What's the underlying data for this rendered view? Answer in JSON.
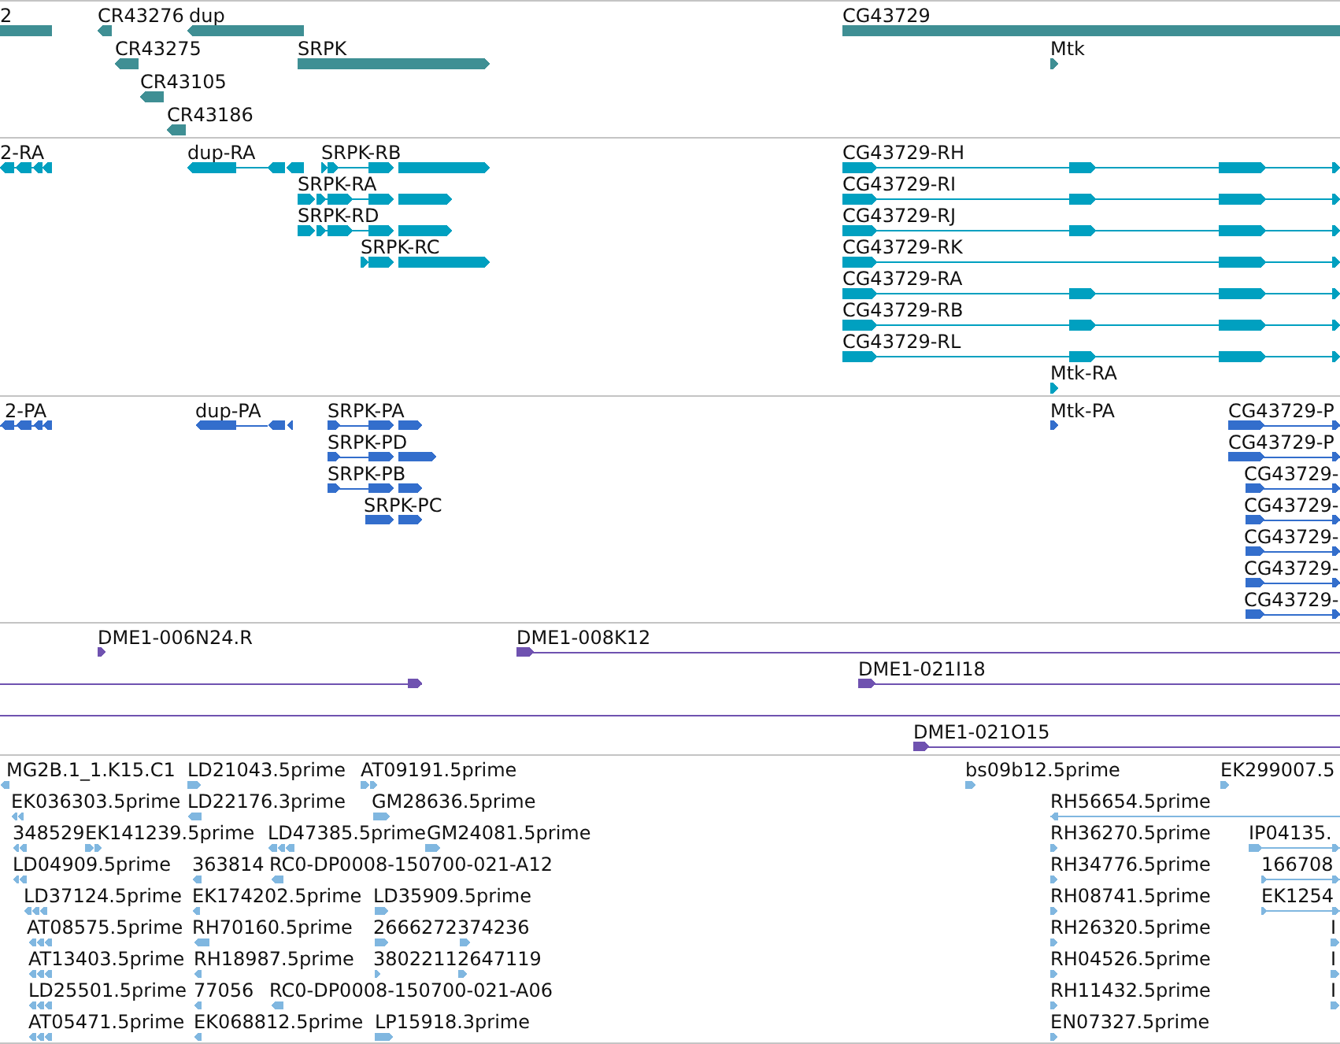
{
  "tracks": [
    {
      "kind": "gene",
      "color": "#3f8f94",
      "features": [
        {
          "label": "2"
        },
        {
          "label": "CR43276",
          "reverse": true
        },
        {
          "label": "dup",
          "reverse": true
        },
        {
          "label": "CG43729"
        },
        {
          "label": "CR43275",
          "reverse": true
        },
        {
          "label": "SRPK",
          "reverse": false
        },
        {
          "label": "Mtk",
          "reverse": false
        },
        {
          "label": "CR43105",
          "reverse": true
        },
        {
          "label": "CR43186",
          "reverse": true
        }
      ]
    },
    {
      "kind": "transcript",
      "color": "#00a0c0",
      "features": [
        {
          "label": "2-RA",
          "reverse": true
        },
        {
          "label": "dup-RA",
          "reverse": true
        },
        {
          "label": "SRPK-RB",
          "reverse": false
        },
        {
          "label": "CG43729-RH",
          "reverse": false
        },
        {
          "label": "SRPK-RA",
          "reverse": false
        },
        {
          "label": "CG43729-RI",
          "reverse": false
        },
        {
          "label": "SRPK-RD",
          "reverse": false
        },
        {
          "label": "CG43729-RJ",
          "reverse": false
        },
        {
          "label": "SRPK-RC",
          "reverse": false
        },
        {
          "label": "CG43729-RK",
          "reverse": false
        },
        {
          "label": "CG43729-RA",
          "reverse": false
        },
        {
          "label": "CG43729-RB",
          "reverse": false
        },
        {
          "label": "CG43729-RL",
          "reverse": false
        },
        {
          "label": "Mtk-RA",
          "reverse": false
        }
      ]
    },
    {
      "kind": "protein",
      "color": "#336ecc",
      "features": [
        {
          "label": "2-PA",
          "reverse": true
        },
        {
          "label": "dup-PA",
          "reverse": true
        },
        {
          "label": "SRPK-PA",
          "reverse": false
        },
        {
          "label": "Mtk-PA",
          "reverse": false
        },
        {
          "label": "CG43729-P",
          "reverse": false
        },
        {
          "label": "SRPK-PD",
          "reverse": false
        },
        {
          "label": "CG43729-P",
          "reverse": false
        },
        {
          "label": "SRPK-PB",
          "reverse": false
        },
        {
          "label": "CG43729-",
          "reverse": false
        },
        {
          "label": "SRPK-PC",
          "reverse": false
        },
        {
          "label": "CG43729-",
          "reverse": false
        },
        {
          "label": "CG43729-",
          "reverse": false
        },
        {
          "label": "CG43729-",
          "reverse": false
        },
        {
          "label": "CG43729-",
          "reverse": false
        }
      ]
    },
    {
      "kind": "clone",
      "color": "#6f52b0",
      "features": [
        {
          "kind": "arrow",
          "label": "DME1-006N24.R",
          "reverse": false
        },
        {
          "kind": "arrow",
          "label": "DME1-008K12",
          "reverse": false
        },
        {
          "kind": "arrow",
          "reverse": false
        },
        {
          "kind": "arrow",
          "label": "DME1-021I18",
          "reverse": false
        },
        {
          "kind": "line"
        },
        {
          "kind": "arrow",
          "label": "DME1-021O15",
          "reverse": false
        }
      ]
    },
    {
      "kind": "est",
      "color": "#80b7e0",
      "features": [
        {
          "label": "MG2B.1_1.K15.C1",
          "reverse": true
        },
        {
          "label": "LD21043.5prime",
          "reverse": false
        },
        {
          "label": "AT09191.5prime",
          "reverse": false
        },
        {
          "label": "bs09b12.5prime",
          "reverse": false
        },
        {
          "label": "EK299007.5",
          "reverse": false
        },
        {
          "label": "EK036303.5prime",
          "reverse": true
        },
        {
          "label": "LD22176.3prime",
          "reverse": true
        },
        {
          "label": "GM28636.5prime",
          "reverse": false
        },
        {
          "label": "RH56654.5prime",
          "reverse": true
        },
        {
          "label": "348529",
          "reverse": true
        },
        {
          "label": "EK141239.5prime",
          "reverse": false
        },
        {
          "label": "LD47385.5prime",
          "reverse": true
        },
        {
          "label": "GM24081.5prime",
          "reverse": false
        },
        {
          "label": "RH36270.5prime",
          "reverse": false
        },
        {
          "label": "IP04135.",
          "reverse": false
        },
        {
          "label": "LD04909.5prime",
          "reverse": true
        },
        {
          "label": "363814",
          "reverse": true
        },
        {
          "label": "RC0-DP0008-150700-021-A12",
          "reverse": true
        },
        {
          "label": "RH34776.5prime",
          "reverse": false
        },
        {
          "label": "166708",
          "reverse": false
        },
        {
          "label": "LD37124.5prime",
          "reverse": true
        },
        {
          "label": "EK174202.5prime",
          "reverse": true
        },
        {
          "label": "LD35909.5prime",
          "reverse": false
        },
        {
          "label": "RH08741.5prime",
          "reverse": false
        },
        {
          "label": "EK1254",
          "reverse": false
        },
        {
          "label": "AT08575.5prime",
          "reverse": true
        },
        {
          "label": "RH70160.5prime",
          "reverse": true
        },
        {
          "label": "2666272374236",
          "reverse": false
        },
        {
          "reverse": false
        },
        {
          "label": "RH26320.5prime",
          "reverse": false
        },
        {
          "label": "I",
          "reverse": false
        },
        {
          "label": "AT13403.5prime",
          "reverse": true
        },
        {
          "label": "RH18987.5prime",
          "reverse": true
        },
        {
          "label": "38022112647119",
          "reverse": false
        },
        {
          "reverse": false
        },
        {
          "label": "RH04526.5prime",
          "reverse": false
        },
        {
          "label": "I",
          "reverse": false
        },
        {
          "label": "LD25501.5prime",
          "reverse": true
        },
        {
          "label": "77056",
          "reverse": true
        },
        {
          "label": "RC0-DP0008-150700-021-A06",
          "reverse": true
        },
        {
          "label": "RH11432.5prime",
          "reverse": false
        },
        {
          "label": "I",
          "reverse": false
        },
        {
          "label": "AT05471.5prime",
          "reverse": true
        },
        {
          "label": "EK068812.5prime",
          "reverse": true
        },
        {
          "label": "LP15918.3prime",
          "reverse": false
        },
        {
          "label": "EN07327.5prime",
          "reverse": false
        }
      ]
    }
  ]
}
